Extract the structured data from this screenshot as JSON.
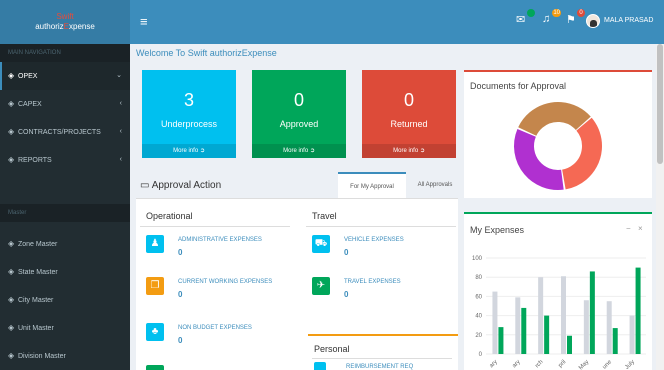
{
  "logo": {
    "line1": "Swift",
    "line2_a": "authoriz",
    "line2_b": "E",
    "line2_c": "xpense"
  },
  "header": {
    "menu_icon": "hamburger-icon",
    "icons": [
      {
        "name": "envelope-icon",
        "badge": "",
        "color": "#00a65a"
      },
      {
        "name": "bell-icon",
        "badge": "10",
        "color": "#f39c12"
      },
      {
        "name": "flag-icon",
        "badge": "0",
        "color": "#dd4b39"
      }
    ],
    "user_name": "MALA PRASAD"
  },
  "sidebar": {
    "nav_header": "MAIN NAVIGATION",
    "items": [
      {
        "label": "OPEX",
        "chevron": "⌄"
      },
      {
        "label": "CAPEX",
        "chevron": "‹"
      },
      {
        "label": "CONTRACTS/PROJECTS",
        "chevron": "‹"
      },
      {
        "label": "REPORTS",
        "chevron": "‹"
      }
    ],
    "master_header": "Master",
    "master_items": [
      {
        "label": "Zone Master"
      },
      {
        "label": "State Master"
      },
      {
        "label": "City Master"
      },
      {
        "label": "Unit Master"
      },
      {
        "label": "Division Master"
      }
    ]
  },
  "welcome": "Welcome To Swift authorizExpense",
  "tiles": [
    {
      "value": "3",
      "label": "Underprocess",
      "more": "More info",
      "color": "#00c0ef"
    },
    {
      "value": "0",
      "label": "Approved",
      "more": "More info",
      "color": "#00a65a"
    },
    {
      "value": "0",
      "label": "Returned",
      "more": "More info",
      "color": "#dd4b39"
    }
  ],
  "documents": {
    "title": "Documents for Approval",
    "segments": [
      {
        "share": 0.34,
        "color": "#f56954"
      },
      {
        "share": 0.34,
        "color": "#b030d0"
      },
      {
        "share": 0.32,
        "color": "#c4864c"
      }
    ]
  },
  "approval": {
    "title": "Approval Action",
    "tabs": [
      {
        "label": "For My Approval"
      },
      {
        "label": "All Approvals"
      }
    ],
    "operational": {
      "title": "Operational",
      "entries": [
        {
          "label": "ADMINISTRATIVE EXPENSES",
          "value": "0",
          "icon": "user-icon",
          "color": "#00c0ef"
        },
        {
          "label": "CURRENT WORKING EXPENSES",
          "value": "0",
          "icon": "copy-icon",
          "color": "#f39c12"
        },
        {
          "label": "NON BUDGET EXPENSES",
          "value": "0",
          "icon": "group-icon",
          "color": "#00c0ef"
        }
      ]
    },
    "travel": {
      "title": "Travel",
      "entries": [
        {
          "label": "VEHICLE EXPENSES",
          "value": "0",
          "icon": "car-icon",
          "color": "#00c0ef"
        },
        {
          "label": "TRAVEL EXPENSES",
          "value": "0",
          "icon": "plane-icon",
          "color": "#00a65a"
        }
      ]
    },
    "personal": {
      "title": "Personal",
      "entry_label": "REIMBURSEMENT REQ"
    }
  },
  "expenses": {
    "title": "My Expenses",
    "minimize": "−",
    "close": "×"
  },
  "chart_data": {
    "type": "bar",
    "title": "",
    "categories": [
      "January",
      "February",
      "March",
      "April",
      "May",
      "June",
      "July"
    ],
    "category_labels": [
      "ary",
      "ary",
      "rch",
      "pril",
      "May",
      "une",
      "July"
    ],
    "series": [
      {
        "values": [
          65,
          59,
          80,
          81,
          56,
          55,
          40
        ],
        "color": "#d2d6de"
      },
      {
        "values": [
          28,
          48,
          40,
          19,
          86,
          27,
          90
        ],
        "color": "#00a65a"
      }
    ],
    "yticks": [
      0,
      20,
      40,
      60,
      80,
      100
    ],
    "ylim": [
      0,
      100
    ],
    "grid": true
  },
  "scrollbar": {
    "visible": true
  }
}
